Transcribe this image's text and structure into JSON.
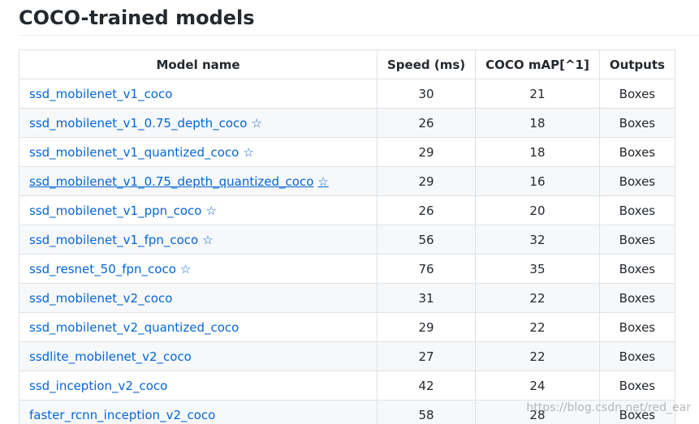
{
  "heading": "COCO-trained models",
  "table": {
    "headers": {
      "name": "Model name",
      "speed": "Speed (ms)",
      "map": "COCO mAP[^1]",
      "outputs": "Outputs"
    },
    "star_glyph": "☆",
    "rows": [
      {
        "name": "ssd_mobilenet_v1_coco",
        "star": false,
        "speed": "30",
        "map": "21",
        "outputs": "Boxes"
      },
      {
        "name": "ssd_mobilenet_v1_0.75_depth_coco",
        "star": true,
        "speed": "26",
        "map": "18",
        "outputs": "Boxes"
      },
      {
        "name": "ssd_mobilenet_v1_quantized_coco",
        "star": true,
        "speed": "29",
        "map": "18",
        "outputs": "Boxes"
      },
      {
        "name": "ssd_mobilenet_v1_0.75_depth_quantized_coco",
        "star": true,
        "speed": "29",
        "map": "16",
        "outputs": "Boxes"
      },
      {
        "name": "ssd_mobilenet_v1_ppn_coco",
        "star": true,
        "speed": "26",
        "map": "20",
        "outputs": "Boxes"
      },
      {
        "name": "ssd_mobilenet_v1_fpn_coco",
        "star": true,
        "speed": "56",
        "map": "32",
        "outputs": "Boxes"
      },
      {
        "name": "ssd_resnet_50_fpn_coco",
        "star": true,
        "speed": "76",
        "map": "35",
        "outputs": "Boxes"
      },
      {
        "name": "ssd_mobilenet_v2_coco",
        "star": false,
        "speed": "31",
        "map": "22",
        "outputs": "Boxes"
      },
      {
        "name": "ssd_mobilenet_v2_quantized_coco",
        "star": false,
        "speed": "29",
        "map": "22",
        "outputs": "Boxes"
      },
      {
        "name": "ssdlite_mobilenet_v2_coco",
        "star": false,
        "speed": "27",
        "map": "22",
        "outputs": "Boxes"
      },
      {
        "name": "ssd_inception_v2_coco",
        "star": false,
        "speed": "42",
        "map": "24",
        "outputs": "Boxes"
      },
      {
        "name": "faster_rcnn_inception_v2_coco",
        "star": false,
        "speed": "58",
        "map": "28",
        "outputs": "Boxes"
      }
    ],
    "hovered_row_index": 3
  },
  "watermark": "https://blog.csdn.net/red_ear",
  "colors": {
    "link": "#0366d6",
    "text": "#24292e",
    "border": "#dfe2e5",
    "stripe": "#f6f8fa"
  }
}
